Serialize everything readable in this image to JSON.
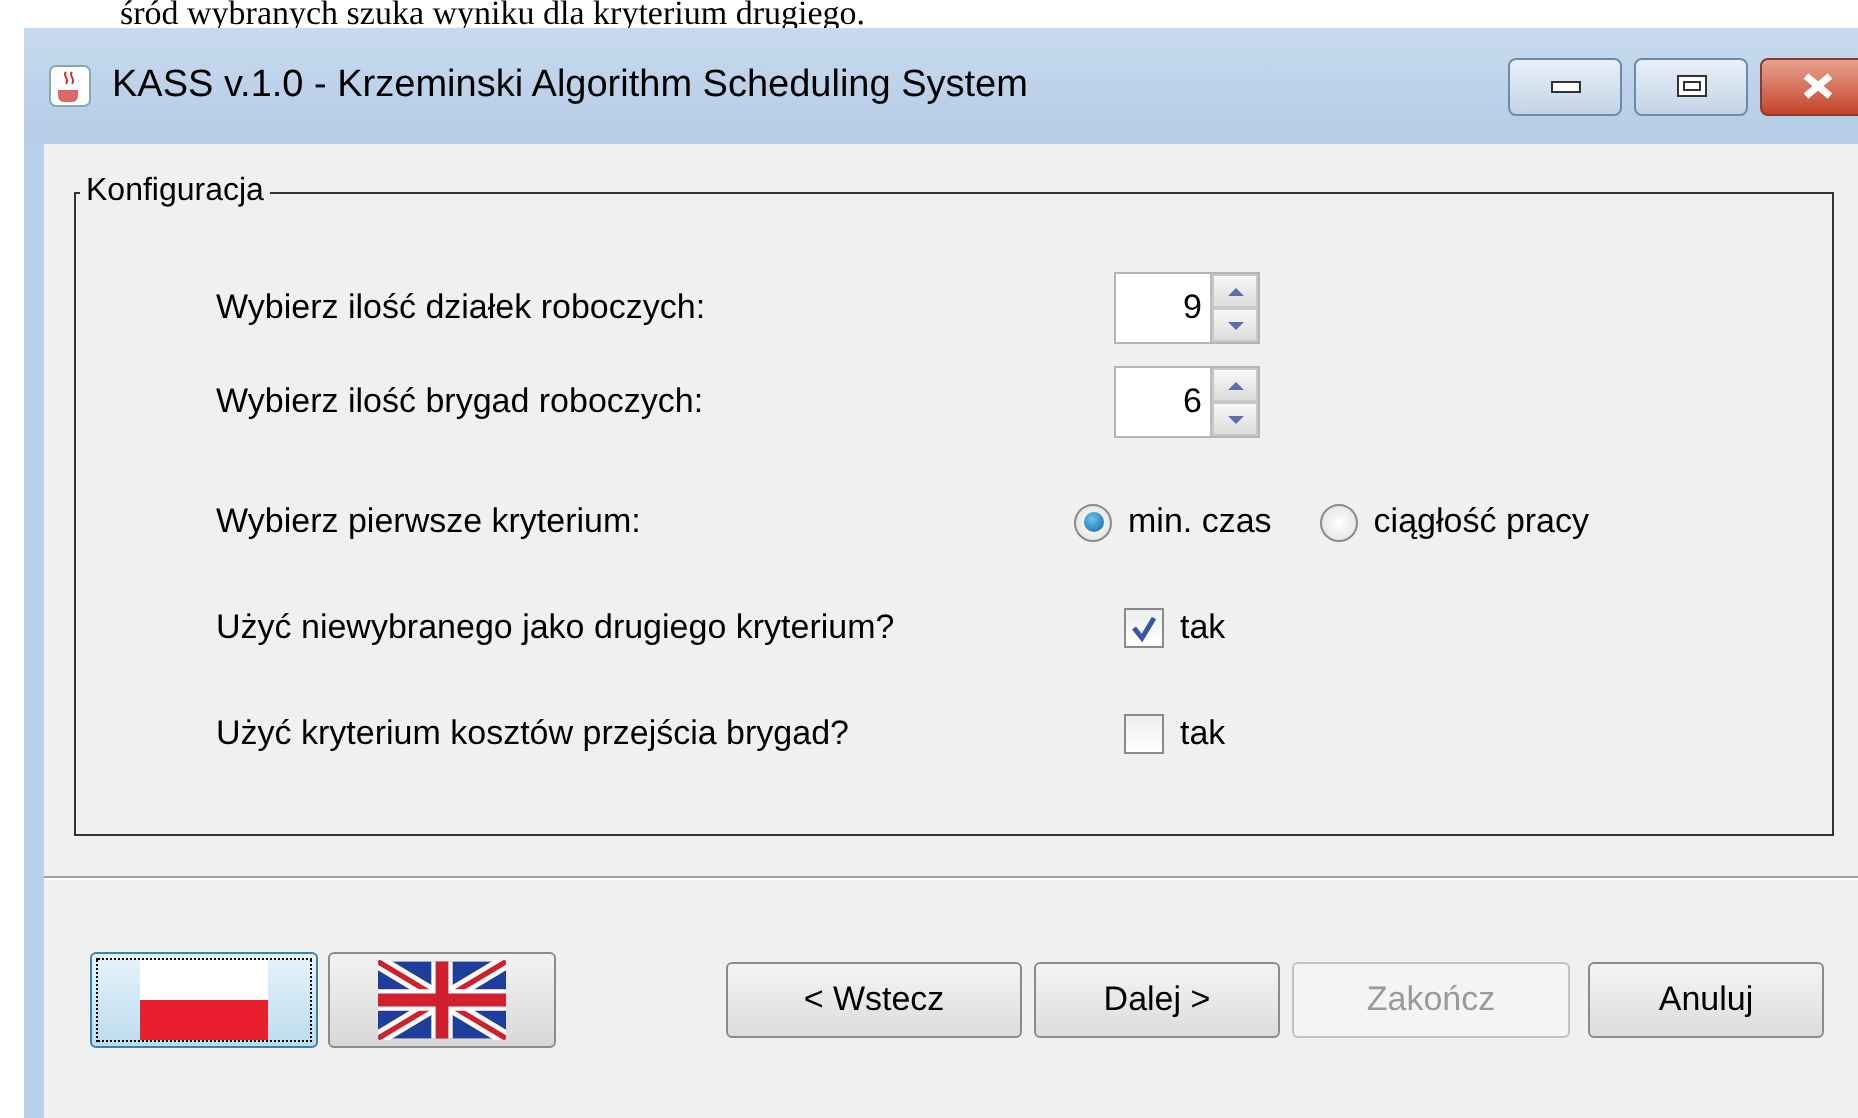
{
  "document_text": "śród wybranych szuka wyniku dla kryterium drugiego.",
  "window": {
    "title": "KASS v.1.0 - Krzeminski Algorithm Scheduling System"
  },
  "group": {
    "title": "Konfiguracja",
    "rows": [
      {
        "kind": "spinner",
        "label": "Wybierz ilość działek roboczych:",
        "value": "9"
      },
      {
        "kind": "spinner",
        "label": "Wybierz ilość brygad roboczych:",
        "value": "6"
      },
      {
        "kind": "radio",
        "label": "Wybierz pierwsze kryterium:",
        "options": [
          {
            "label": "min. czas",
            "selected": true
          },
          {
            "label": "ciągłość pracy",
            "selected": false
          }
        ]
      },
      {
        "kind": "checkbox",
        "label": "Użyć niewybranego jako drugiego kryterium?",
        "option": "tak",
        "checked": true
      },
      {
        "kind": "checkbox",
        "label": "Użyć kryterium kosztów przejścia brygad?",
        "option": "tak",
        "checked": false
      }
    ]
  },
  "language_buttons": [
    {
      "kind": "pl",
      "selected": true
    },
    {
      "kind": "en",
      "selected": false
    }
  ],
  "nav_buttons": [
    {
      "label": "< Wstecz",
      "disabled": false
    },
    {
      "label": "Dalej >",
      "disabled": false
    },
    {
      "label": "Zakończ",
      "disabled": true
    },
    {
      "label": "Anuluj",
      "disabled": false
    }
  ]
}
